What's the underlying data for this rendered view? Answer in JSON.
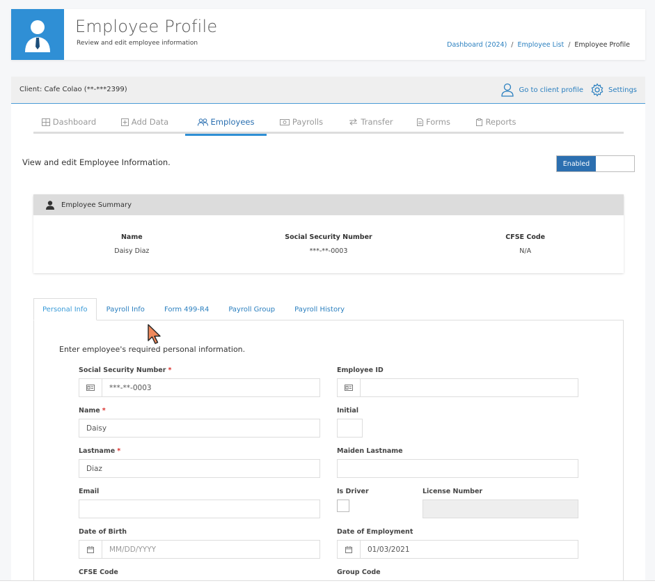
{
  "header": {
    "title": "Employee Profile",
    "subtitle": "Review and edit employee information",
    "breadcrumb": [
      "Dashboard (2024)",
      "Employee List",
      "Employee Profile"
    ]
  },
  "client_bar": {
    "client": "Client: Cafe Colao (**-***2399)",
    "go_to_client": "Go to client profile",
    "settings": "Settings"
  },
  "nav_tabs": [
    {
      "label": "Dashboard",
      "icon": "grid-icon"
    },
    {
      "label": "Add Data",
      "icon": "plus-square-icon"
    },
    {
      "label": "Employees",
      "icon": "users-icon"
    },
    {
      "label": "Payrolls",
      "icon": "money-icon"
    },
    {
      "label": "Transfer",
      "icon": "transfer-icon"
    },
    {
      "label": "Forms",
      "icon": "document-icon"
    },
    {
      "label": "Reports",
      "icon": "clipboard-icon"
    }
  ],
  "intro": "View and edit Employee Information.",
  "toggle": {
    "label": "Enabled"
  },
  "summary": {
    "title": "Employee Summary",
    "columns": [
      {
        "label": "Name",
        "value": "Daisy Diaz"
      },
      {
        "label": "Social Security Number",
        "value": "***-**-0003"
      },
      {
        "label": "CFSE Code",
        "value": "N/A"
      }
    ]
  },
  "sub_tabs": [
    "Personal Info",
    "Payroll Info",
    "Form 499-R4",
    "Payroll Group",
    "Payroll History"
  ],
  "form": {
    "intro": "Enter employee's required personal information.",
    "ssn_label": "Social Security Number",
    "ssn_value": "***-**-0003",
    "employee_id_label": "Employee ID",
    "employee_id_value": "",
    "name_label": "Name",
    "name_value": "Daisy",
    "initial_label": "Initial",
    "initial_value": "",
    "lastname_label": "Lastname",
    "lastname_value": "Diaz",
    "maiden_label": "Maiden Lastname",
    "maiden_value": "",
    "email_label": "Email",
    "email_value": "",
    "driver_label": "Is Driver",
    "license_label": "License Number",
    "license_value": "",
    "dob_label": "Date of Birth",
    "dob_placeholder": "MM/DD/YYYY",
    "doe_label": "Date of Employment",
    "doe_value": "01/03/2021",
    "cfse_label": "CFSE Code",
    "group_label": "Group Code",
    "required_mark": "*"
  },
  "colors": {
    "accent": "#2f8fd5",
    "toggle": "#2c6fb0",
    "required": "#d9302c"
  }
}
